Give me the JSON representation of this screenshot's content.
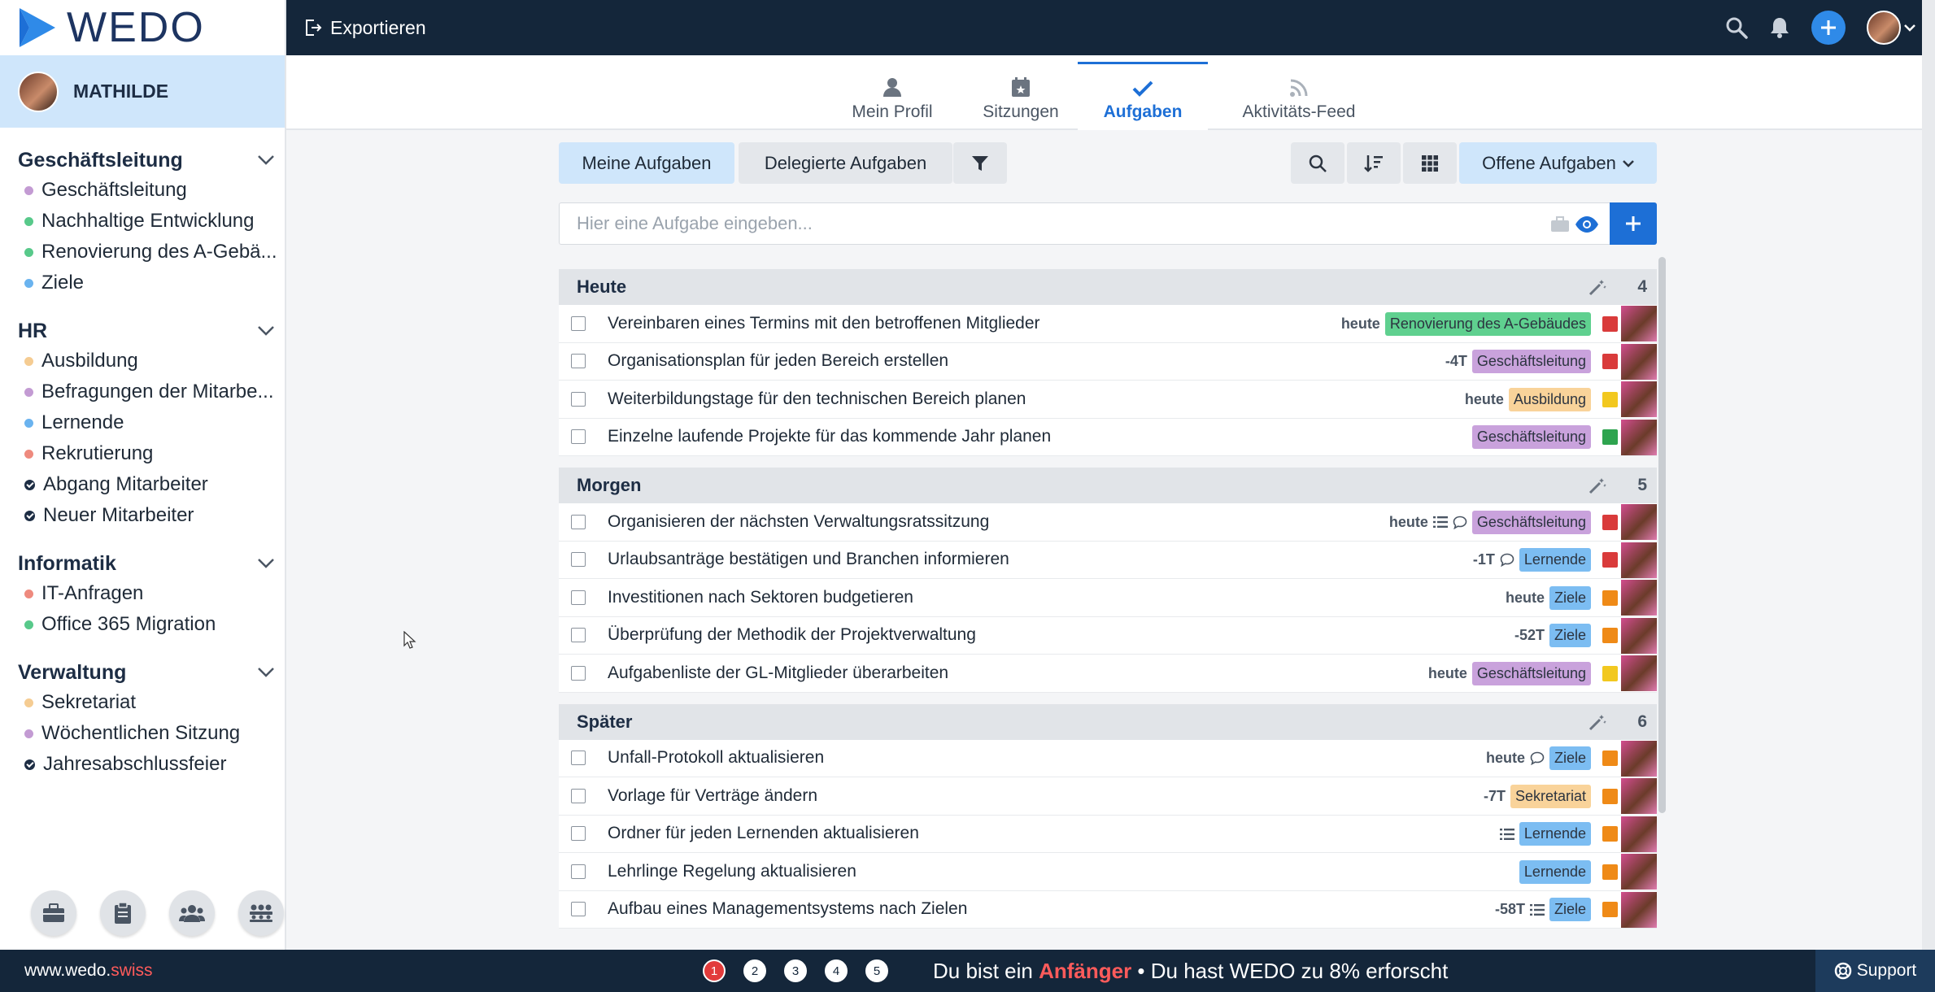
{
  "brand": {
    "logo_text": "WEDO"
  },
  "user": {
    "name": "MATHILDE"
  },
  "sidebar": {
    "groups": [
      {
        "title": "Geschäftsleitung",
        "items": [
          {
            "label": "Geschäftsleitung",
            "color": "#c39bd3"
          },
          {
            "label": "Nachhaltige Entwicklung",
            "color": "#58c98a"
          },
          {
            "label": "Renovierung des A-Gebä...",
            "color": "#58c98a"
          },
          {
            "label": "Ziele",
            "color": "#6ab3ef"
          }
        ]
      },
      {
        "title": "HR",
        "items": [
          {
            "label": "Ausbildung",
            "color": "#f5cc92"
          },
          {
            "label": "Befragungen der Mitarbe...",
            "color": "#c39bd3"
          },
          {
            "label": "Lernende",
            "color": "#6ab3ef"
          },
          {
            "label": "Rekrutierung",
            "color": "#ee8a7e"
          },
          {
            "label": "Abgang Mitarbeiter",
            "icon": "check-circle-icon"
          },
          {
            "label": "Neuer Mitarbeiter",
            "icon": "check-circle-icon"
          }
        ]
      },
      {
        "title": "Informatik",
        "items": [
          {
            "label": "IT-Anfragen",
            "color": "#ee8a7e"
          },
          {
            "label": "Office 365 Migration",
            "color": "#58c98a"
          }
        ]
      },
      {
        "title": "Verwaltung",
        "items": [
          {
            "label": "Sekretariat",
            "color": "#f5cc92"
          },
          {
            "label": "Wöchentlichen Sitzung",
            "color": "#c39bd3"
          },
          {
            "label": "Jahresabschlussfeier",
            "icon": "check-circle-icon"
          }
        ]
      }
    ],
    "tools": [
      "briefcase-icon",
      "clipboard-icon",
      "users-icon",
      "team-icon"
    ]
  },
  "topbar": {
    "export_label": "Exportieren",
    "icons": [
      "search-icon",
      "bell-icon",
      "plus-icon",
      "avatar"
    ]
  },
  "tabs": [
    {
      "label": "Mein Profil",
      "icon": "user-icon"
    },
    {
      "label": "Sitzungen",
      "icon": "calendar-icon"
    },
    {
      "label": "Aufgaben",
      "icon": "check-icon",
      "active": true
    },
    {
      "label": "Aktivitäts-Feed",
      "icon": "rss-icon"
    }
  ],
  "toolbar": {
    "my_tasks": "Meine Aufgaben",
    "delegated_tasks": "Delegierte Aufgaben",
    "open_tasks": "Offene Aufgaben"
  },
  "task_input": {
    "placeholder": "Hier eine Aufgabe eingeben..."
  },
  "sections": [
    {
      "title": "Heute",
      "count": "4",
      "tasks": [
        {
          "title": "Vereinbaren eines Termins mit den betroffenen Mitglieder",
          "due": "heute",
          "tag": "Renovierung des A-Gebäudes",
          "tag_color": "#5fd08f",
          "prio": "#d93b3b"
        },
        {
          "title": "Organisationsplan für jeden Bereich erstellen",
          "due": "-4T",
          "tag": "Geschäftsleitung",
          "tag_color": "#c9a2dc",
          "prio": "#d93b3b"
        },
        {
          "title": "Weiterbildungstage für den technischen Bereich planen",
          "due": "heute",
          "tag": "Ausbildung",
          "tag_color": "#f9d39a",
          "prio": "#f2c81f"
        },
        {
          "title": "Einzelne laufende Projekte für das kommende Jahr planen",
          "due": "",
          "tag": "Geschäftsleitung",
          "tag_color": "#c9a2dc",
          "prio": "#2ea44f"
        }
      ]
    },
    {
      "title": "Morgen",
      "count": "5",
      "tasks": [
        {
          "title": "Organisieren der nächsten Verwaltungsratssitzung",
          "due": "heute",
          "list": true,
          "comment": true,
          "tag": "Geschäftsleitung",
          "tag_color": "#c9a2dc",
          "prio": "#d93b3b"
        },
        {
          "title": "Urlaubsanträge bestätigen und Branchen informieren",
          "due": "-1T",
          "comment": true,
          "tag": "Lernende",
          "tag_color": "#7cbdf2",
          "prio": "#d93b3b"
        },
        {
          "title": "Investitionen nach Sektoren budgetieren",
          "due": "heute",
          "tag": "Ziele",
          "tag_color": "#7cbdf2",
          "prio": "#ef8a17"
        },
        {
          "title": "Überprüfung der Methodik der Projektverwaltung",
          "due": "-52T",
          "tag": "Ziele",
          "tag_color": "#7cbdf2",
          "prio": "#ef8a17"
        },
        {
          "title": "Aufgabenliste der GL-Mitglieder überarbeiten",
          "due": "heute",
          "tag": "Geschäftsleitung",
          "tag_color": "#c9a2dc",
          "prio": "#f2c81f"
        }
      ]
    },
    {
      "title": "Später",
      "count": "6",
      "tasks": [
        {
          "title": "Unfall-Protokoll aktualisieren",
          "due": "heute",
          "comment": true,
          "tag": "Ziele",
          "tag_color": "#7cbdf2",
          "prio": "#ef8a17"
        },
        {
          "title": "Vorlage für Verträge ändern",
          "due": "-7T",
          "tag": "Sekretariat",
          "tag_color": "#f9d39a",
          "prio": "#ef8a17"
        },
        {
          "title": "Ordner für jeden Lernenden aktualisieren",
          "due": "",
          "list": true,
          "tag": "Lernende",
          "tag_color": "#7cbdf2",
          "prio": "#ef8a17"
        },
        {
          "title": "Lehrlinge Regelung aktualisieren",
          "due": "",
          "tag": "Lernende",
          "tag_color": "#7cbdf2",
          "prio": "#ef8a17"
        },
        {
          "title": "Aufbau eines Managementsystems nach Zielen",
          "due": "-58T",
          "list": true,
          "tag": "Ziele",
          "tag_color": "#7cbdf2",
          "prio": "#ef8a17"
        }
      ]
    }
  ],
  "footer": {
    "site_main": "www.wedo.",
    "site_tld": "swiss",
    "steps": [
      "1",
      "2",
      "3",
      "4",
      "5"
    ],
    "msg_pre": "Du bist ein ",
    "msg_level": "Anfänger",
    "msg_post": " • Du hast WEDO zu 8% erforscht",
    "support": "Support"
  }
}
